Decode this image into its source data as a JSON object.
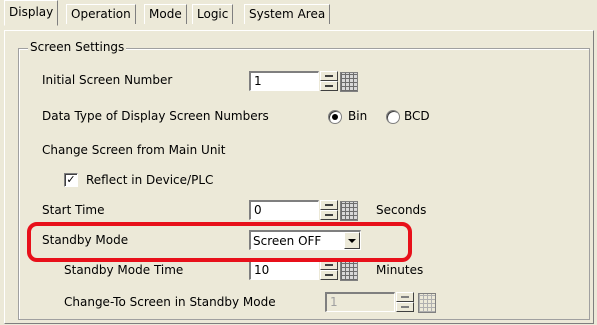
{
  "tabs": [
    {
      "label": "Display",
      "active": true
    },
    {
      "label": "Operation",
      "active": false
    },
    {
      "label": "Mode",
      "active": false
    },
    {
      "label": "Logic",
      "active": false
    },
    {
      "label": "System Area",
      "active": false
    }
  ],
  "group": {
    "title": "Screen Settings"
  },
  "settings": {
    "initial_screen_number": {
      "label": "Initial Screen Number",
      "value": "1"
    },
    "data_type": {
      "label": "Data Type of Display Screen Numbers",
      "options": [
        "Bin",
        "BCD"
      ],
      "selected": "Bin"
    },
    "change_screen": {
      "label": "Change Screen from Main Unit"
    },
    "reflect": {
      "label": "Reflect in Device/PLC",
      "checked": true,
      "check_mark": "✓"
    },
    "start_time": {
      "label": "Start Time",
      "value": "0",
      "unit": "Seconds"
    },
    "standby_mode": {
      "label": "Standby Mode",
      "value": "Screen OFF"
    },
    "standby_time": {
      "label": "Standby Mode Time",
      "value": "10",
      "unit": "Minutes"
    },
    "change_to_screen": {
      "label": "Change-To Screen in Standby Mode",
      "value": "1"
    }
  },
  "colors": {
    "background": "#ece9d8",
    "highlight": "#e8101a"
  },
  "icons": {
    "spin": "spin-buttons-icon",
    "keypad": "keypad-icon",
    "dropdown": "chevron-down-icon"
  }
}
